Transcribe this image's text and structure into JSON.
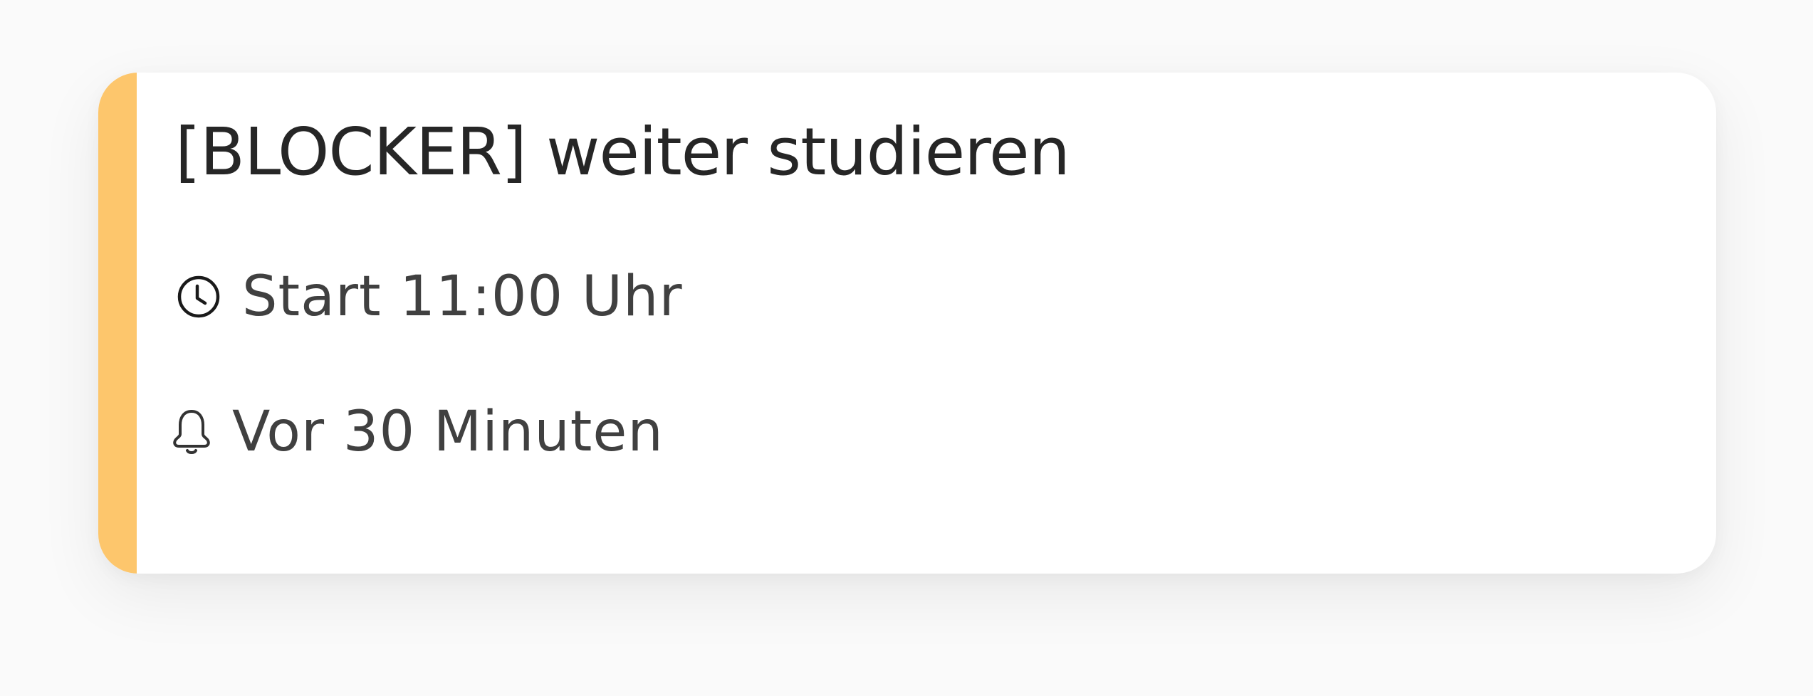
{
  "event": {
    "title": "[BLOCKER] weiter studieren",
    "start_text": "Start 11:00 Uhr",
    "reminder_text": "Vor 30 Minuten",
    "start_icon": "clock-icon",
    "reminder_icon": "bell-icon",
    "accent_color": "#fdc66c"
  }
}
